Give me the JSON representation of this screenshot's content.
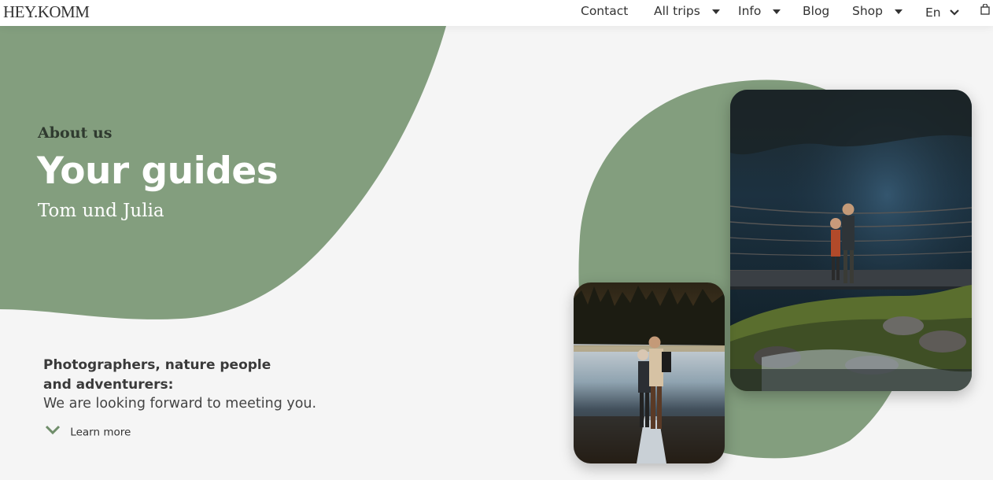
{
  "header": {
    "logo": "HEY.KOMM",
    "nav": {
      "contact": "Contact",
      "all_trips": "All trips",
      "info": "Info",
      "blog": "Blog",
      "shop": "Shop",
      "language": "En"
    }
  },
  "hero": {
    "subtitle": "About us",
    "title": "Your guides",
    "names": "Tom und Julia"
  },
  "intro": {
    "bold": "Photographers, nature people and adventurers:",
    "text": "We are looking forward to meeting you.",
    "learn_more": "Learn more"
  },
  "colors": {
    "accent_green": "#839e7e",
    "background": "#f5f5f5",
    "header_bg": "#ffffff"
  },
  "icons": {
    "dropdown": "caret-down-icon",
    "language": "chevron-down-icon",
    "cart": "shopping-bag-icon",
    "learn_more": "chevron-down-icon"
  }
}
